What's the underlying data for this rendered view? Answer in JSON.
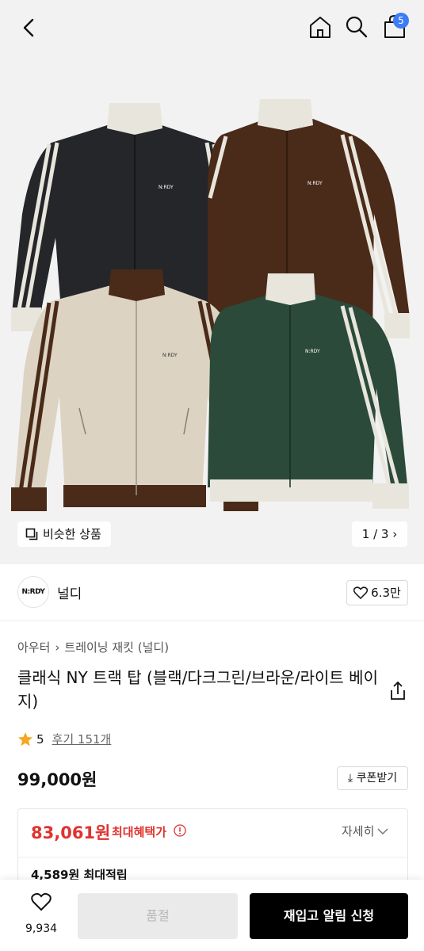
{
  "header": {
    "cart_count": "5",
    "icons": [
      "back-icon",
      "home-icon",
      "search-icon",
      "bag-icon"
    ]
  },
  "gallery": {
    "similar_label": "비슷한 상품",
    "page_indicator": "1 / 3",
    "jacket_logo": "N:RDY",
    "colors": {
      "black": "#25262a",
      "brown": "#4a2a18",
      "beige": "#ddd3c3",
      "green": "#2b4a3a",
      "cream": "#e8e6dc"
    }
  },
  "brand": {
    "logo_text": "N:RDY",
    "name": "널디",
    "likes": "6.3만"
  },
  "breadcrumb": [
    "아우터",
    "트레이닝 재킷 (널디)"
  ],
  "product": {
    "title": "클래식 NY 트랙 탑 (블랙/다크그린/브라운/라이트 베이지)",
    "rating": "5",
    "reviews": "후기 151개",
    "price": "99,000원",
    "coupon": "쿠폰받기"
  },
  "benefit": {
    "price": "83,061원",
    "label": "최대혜택가",
    "detail": "자세히",
    "points": "4,589원 최대적립",
    "accent": "#e0322e"
  },
  "bottom": {
    "wish_count": "9,934",
    "soldout": "품절",
    "restock": "재입고 알림 신청"
  }
}
